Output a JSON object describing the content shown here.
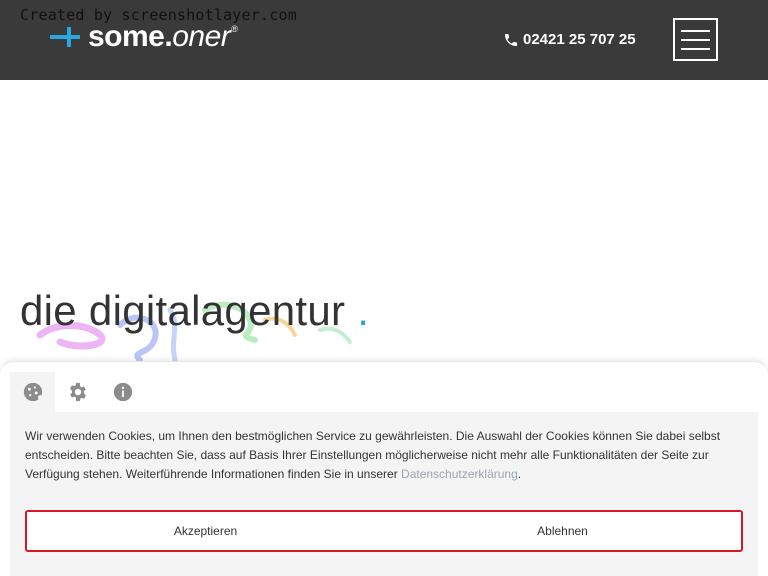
{
  "watermark": "Created by screenshotlayer.com",
  "header": {
    "logo": {
      "prefix": "some",
      "dot": ".",
      "suffix": "oner",
      "reg": "®"
    },
    "phone": "02421 25 707 25"
  },
  "hero": {
    "title": "die digitalagentur",
    "title_accent": "."
  },
  "cookie": {
    "text": "Wir verwenden Cookies, um Ihnen den bestmöglichen Service zu gewährleisten. Die Auswahl der Cookies können Sie dabei selbst entscheiden. Bitte beachten Sie, dass auf Basis Ihrer Einstellungen möglicherweise nicht mehr alle Funktionalitäten der Seite zur Verfügung stehen. Weiterführende Informationen finden Sie in unserer ",
    "link": "Datenschutzerklärung",
    "text_end": ".",
    "accept": "Akzeptieren",
    "decline": "Ablehnen"
  },
  "colors": {
    "header_bg": "#3a3a3a",
    "brand_blue": "#2aa7e0",
    "button_border": "#d7182a"
  }
}
